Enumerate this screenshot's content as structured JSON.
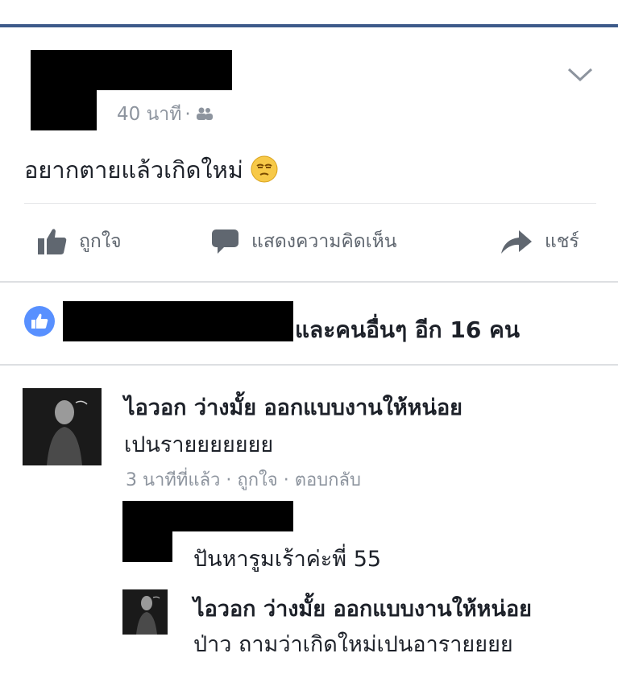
{
  "post": {
    "time": "40 นาที",
    "separator": "·",
    "audience_icon": "friends-icon",
    "text": "อยากตายแล้วเกิดใหม่",
    "emoji_icon": "unamused-face-icon"
  },
  "actions": {
    "like": "ถูกใจ",
    "comment": "แสดงความคิดเห็น",
    "share": "แชร์"
  },
  "likes": {
    "summary": "และคนอื่นๆ อีก 16 คน"
  },
  "comments": [
    {
      "name": "ไอวอก ว่างมั้ย ออกแบบงานให้หน่อย",
      "body": "เปนรายยยยยยย",
      "time": "3 นาทีที่แล้ว",
      "like": "ถูกใจ",
      "reply": "ตอบกลับ",
      "separator": "·"
    }
  ],
  "replies": [
    {
      "body": "ปันหารูมเร้าค่ะพี่ 55"
    },
    {
      "name": "ไอวอก ว่างมั้ย ออกแบบงานให้หน่อย",
      "body": "ป่าว ถามว่าเกิดใหม่เปนอารายยยย"
    }
  ],
  "colors": {
    "accent": "#3d5a8a",
    "like_blue": "#5890ff",
    "meta_gray": "#8d949e",
    "action_gray": "#606770"
  }
}
